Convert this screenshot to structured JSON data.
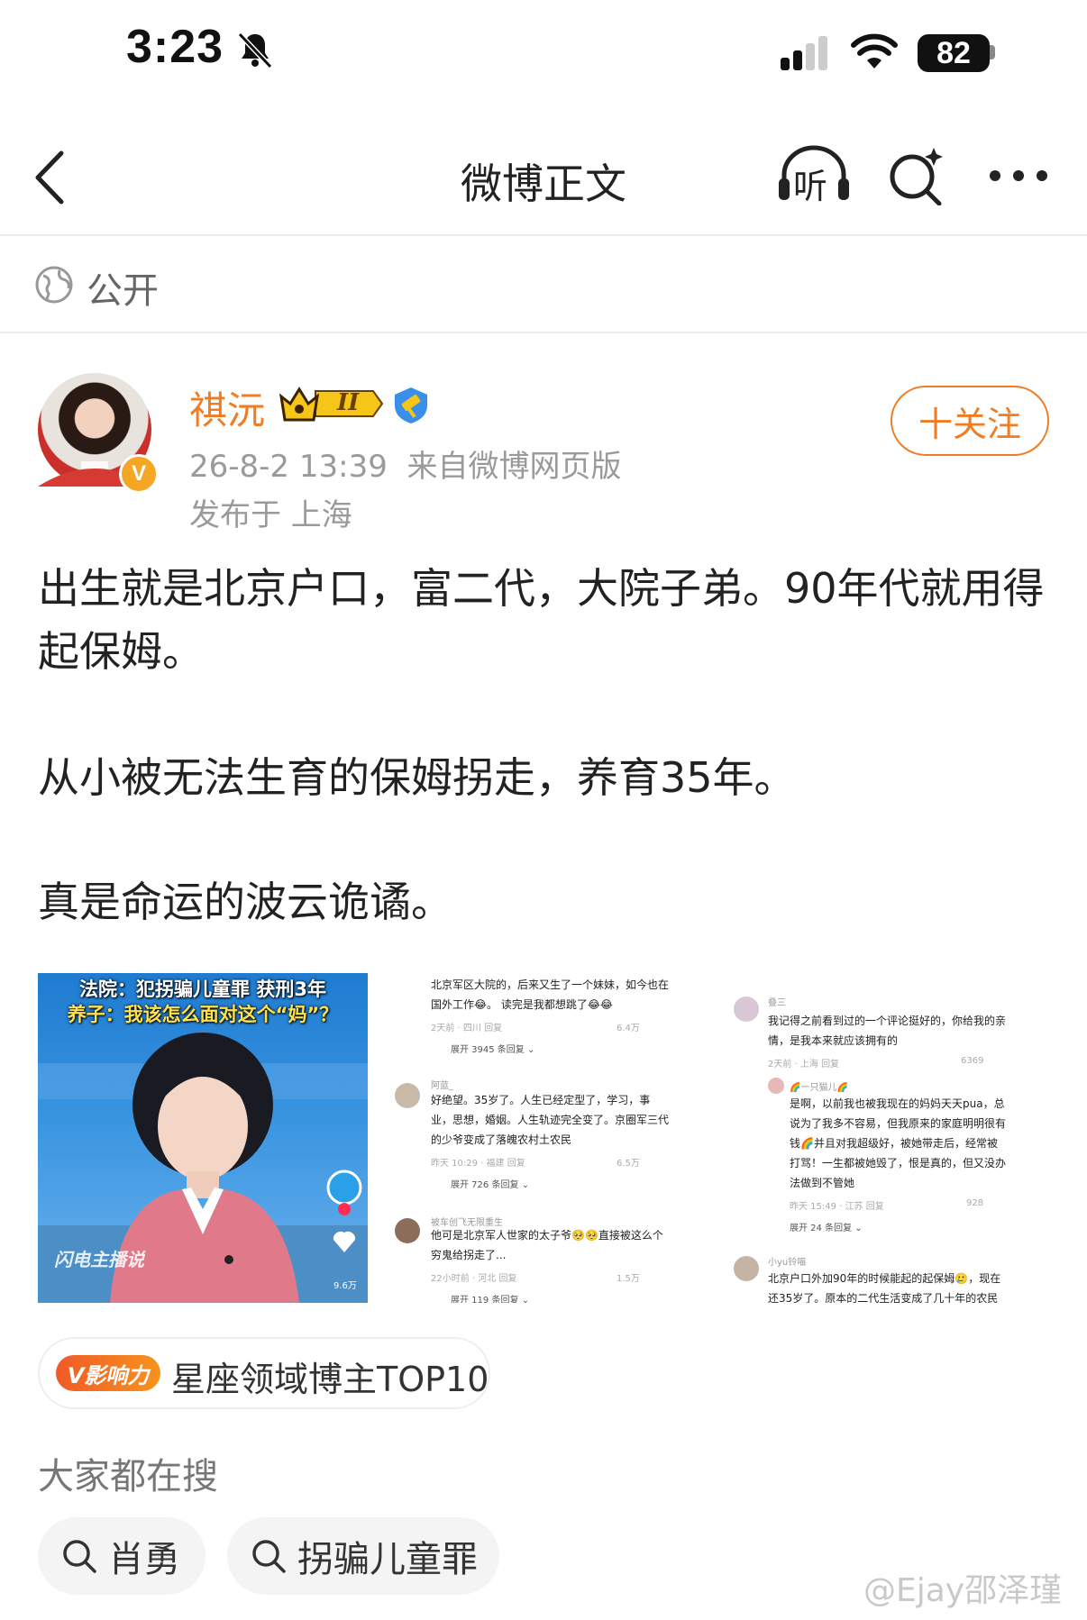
{
  "status_bar": {
    "time": "3:23",
    "battery": "82",
    "icons": [
      "bell-slash-icon",
      "cellular-signal-icon",
      "wifi-icon",
      "battery-icon"
    ]
  },
  "nav": {
    "title": "微博正文",
    "listen_label": "听",
    "icons": [
      "back-icon",
      "listen-icon",
      "search-ai-icon",
      "more-icon"
    ]
  },
  "visibility": {
    "label": "公开",
    "icon": "globe-icon"
  },
  "author": {
    "name": "祺沅",
    "vip_level": "II",
    "badge_letter": "V",
    "meta": "26-8-2 13:39  来自微博网页版",
    "location": "发布于 上海",
    "follow_label": "十关注",
    "accent_color": "#f07c24"
  },
  "post": {
    "paragraphs": [
      "出生就是北京户口，富二代，大院子弟。90年代就用得起保姆。",
      "从小被无法生育的保姆拐走，养育35年。",
      "真是命运的波云诡谲。"
    ]
  },
  "images": {
    "img1": {
      "title_line1": "法院：犯拐骗儿童罪 获刑3年",
      "title_line2": "养子：我该怎么面对这个“妈”？",
      "logo_text": "闪电主播说",
      "likes": "9.6万"
    },
    "img2": {
      "comments": [
        {
          "text_lines": [
            "北京军区大院的，后来又生了一个妹妹，如今也在",
            "国外工作😂。 读完是我都想跳了😂😂"
          ],
          "meta": "2天前 · 四川   回复",
          "likes": "6.4万",
          "expand": "展开 3945 条回复 ⌄"
        },
        {
          "name": "阿蓝_",
          "text_lines": [
            "好绝望。35岁了。人生已经定型了，学习，事",
            "业，思想，婚姻。人生轨迹完全变了。京圈军三代",
            "的少爷变成了落魄农村土农民"
          ],
          "meta": "昨天 10:29 · 福建   回复",
          "likes": "6.5万",
          "expand": "展开 726 条回复 ⌄"
        },
        {
          "name": "被车创飞无限重生",
          "text_lines": [
            "他可是北京军人世家的太子爷🥺🥺直接被这么个",
            "穷鬼给拐走了..."
          ],
          "meta": "22小时前 · 河北   回复",
          "likes": "1.5万",
          "expand": "展开 119 条回复 ⌄"
        }
      ]
    },
    "img3": {
      "comments": [
        {
          "name": "叠三",
          "text_lines": [
            "我记得之前看到过的一个评论挺好的，你给我的亲",
            "情，是我本来就应该拥有的"
          ],
          "meta": "2天前 · 上海   回复",
          "likes": "6369"
        },
        {
          "name": "🌈一只猫儿🌈",
          "text_lines": [
            "是啊，以前我也被我现在的妈妈天天pua，总",
            "说为了我多不容易，但我原来的家庭明明很有",
            "钱🌈并且对我超级好，被她带走后，经常被",
            "打骂！一生都被她毁了，恨是真的，但又没办",
            "法做到不管她"
          ],
          "meta": "昨天 15:49 · 江苏   回复",
          "likes": "928",
          "expand": "展开 24 条回复 ⌄"
        },
        {
          "name": "小yu铃喵",
          "text_lines": [
            "北京户口外加90年的时候能起的起保姆🥲，现在",
            "还35岁了。原本的二代生活变成了几十年的农民"
          ]
        }
      ]
    }
  },
  "influence": {
    "tag": "V影响力",
    "text": "星座领域博主TOP10"
  },
  "search": {
    "heading": "大家都在搜",
    "chips": [
      "肖勇",
      "拐骗儿童罪"
    ]
  },
  "watermark": "@Ejay邵泽瑾"
}
